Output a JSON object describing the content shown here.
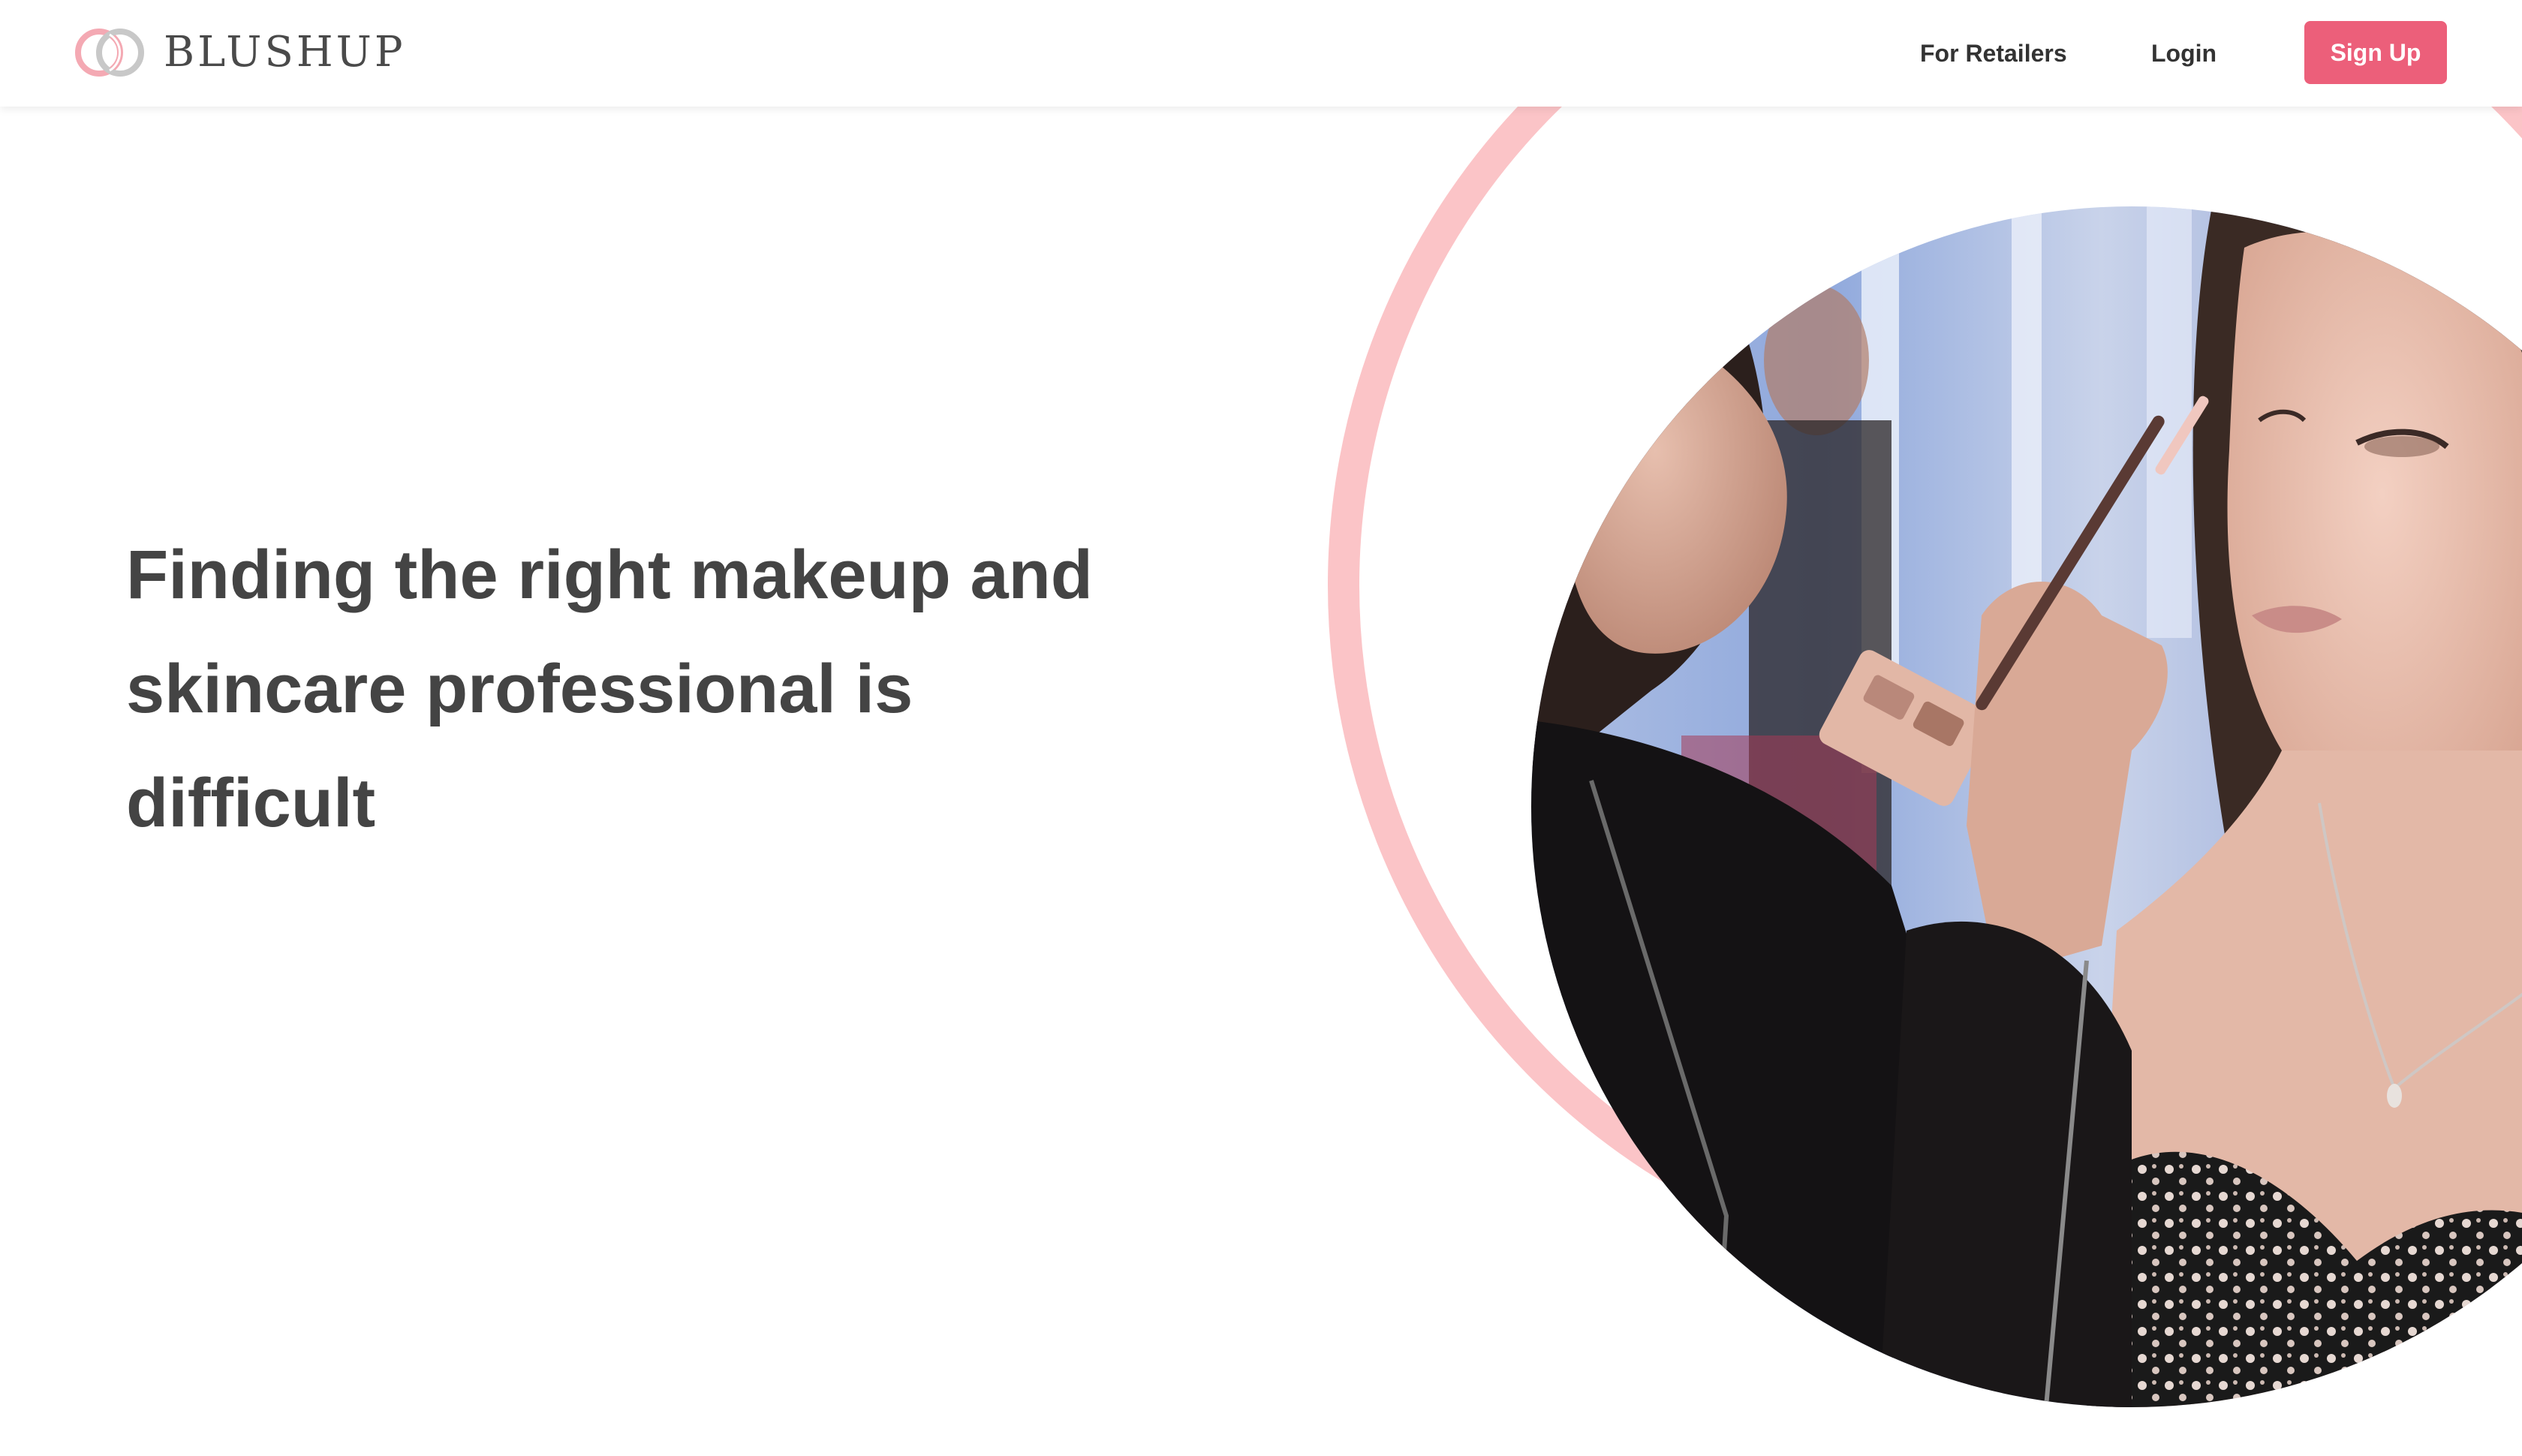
{
  "brand": {
    "name": "BLUSHUP",
    "logo_icon": "interlocking-rings-logo",
    "accent_color": "#ec5f7a",
    "ring_color": "#fbc4c7"
  },
  "nav": {
    "links": [
      {
        "label": "For Retailers"
      },
      {
        "label": "Login"
      }
    ],
    "signup_label": "Sign Up"
  },
  "hero": {
    "heading": "Finding the right makeup and skincare professional is difficult",
    "image_subject": "makeup-artist-applying-eyeshadow-photo"
  }
}
